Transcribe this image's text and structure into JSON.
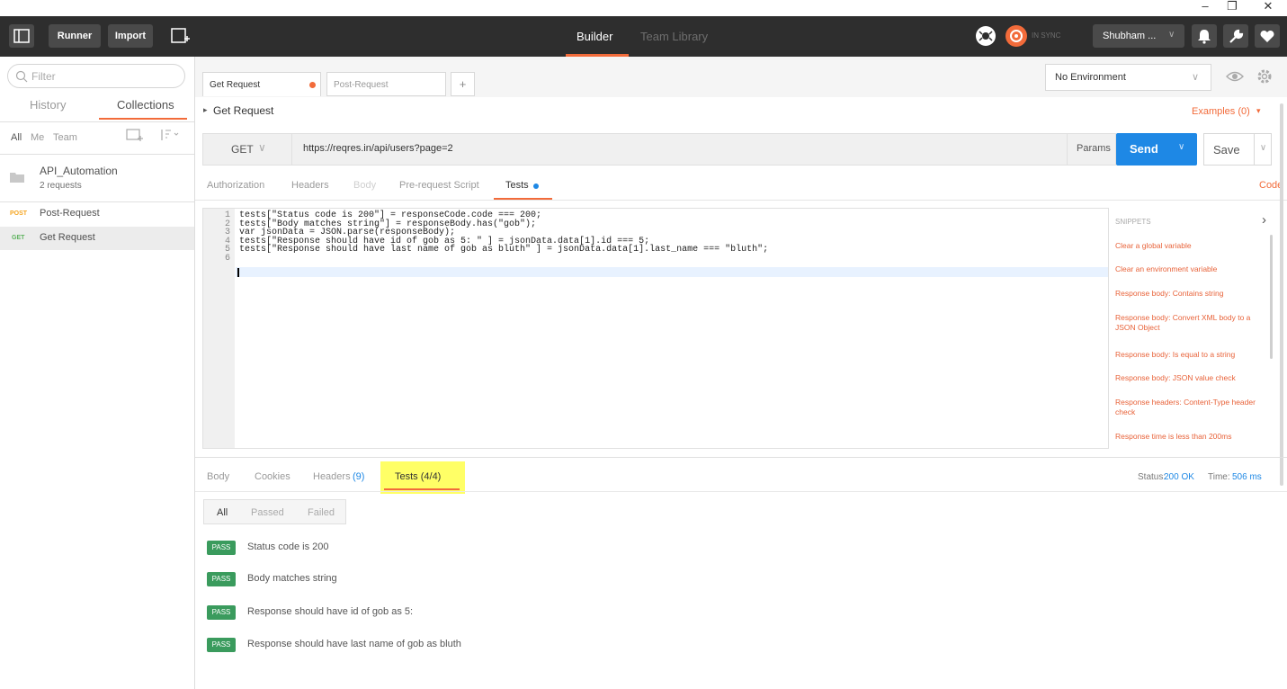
{
  "window": {
    "minimize": "–",
    "maximize": "❐",
    "close": "✕"
  },
  "topbar": {
    "runner": "Runner",
    "import": "Import",
    "builder": "Builder",
    "team_library": "Team Library",
    "sync": "IN SYNC",
    "user": "Shubham ... ",
    "user_caret": "∨"
  },
  "sidebar": {
    "filter_placeholder": "Filter",
    "tabs": [
      "History",
      "Collections"
    ],
    "scopes": [
      "All",
      "Me",
      "Team"
    ],
    "collection": {
      "name": "API_Automation",
      "count": "2 requests"
    },
    "requests": [
      {
        "method": "POST",
        "name": "Post-Request"
      },
      {
        "method": "GET",
        "name": "Get Request"
      }
    ]
  },
  "request_tabs": [
    "Get Request",
    "Post-Request"
  ],
  "add_tab": "+",
  "environment": {
    "selected": "No Environment",
    "caret": "∨"
  },
  "request": {
    "breadcrumb": "Get Request",
    "examples": "Examples (0)",
    "method": "GET",
    "url": "https://reqres.in/api/users?page=2",
    "params": "Params",
    "send": "Send",
    "save": "Save"
  },
  "request_subtabs": [
    "Authorization",
    "Headers",
    "Body",
    "Pre-request Script",
    "Tests"
  ],
  "code_link": "Code",
  "editor": {
    "line_numbers": [
      "1",
      "2",
      "3",
      "4",
      "5",
      "6"
    ],
    "lines": [
      "tests[\"Status code is 200\"] = responseCode.code === 200;",
      "tests[\"Body matches string\"] = responseBody.has(\"gob\");",
      "var jsonData = JSON.parse(responseBody);",
      "tests[\"Response should have id of gob as 5: \" ] = jsonData.data[1].id === 5;",
      "tests[\"Response should have last name of gob as bluth\" ] = jsonData.data[1].last_name === \"bluth\";",
      ""
    ]
  },
  "snippets": {
    "title": "SNIPPETS",
    "items": [
      "Clear a global variable",
      "Clear an environment variable",
      "Response body: Contains string",
      "Response body: Convert XML body to a JSON Object",
      "Response body: Is equal to a string",
      "Response body: JSON value check",
      "Response headers: Content-Type header check",
      "Response time is less than 200ms"
    ]
  },
  "response_tabs": {
    "body": "Body",
    "cookies": "Cookies",
    "headers": "Headers",
    "headers_count": "(9)",
    "tests": "Tests (4/4)"
  },
  "status": {
    "status_label": "Status:",
    "status_value": "200 OK",
    "time_label": "Time:",
    "time_value": "506 ms"
  },
  "filters": [
    "All",
    "Passed",
    "Failed"
  ],
  "results": [
    {
      "badge": "PASS",
      "text": "Status code is 200"
    },
    {
      "badge": "PASS",
      "text": "Body matches string"
    },
    {
      "badge": "PASS",
      "text": "Response should have id of gob as 5:"
    },
    {
      "badge": "PASS",
      "text": "Response should have last name of gob as bluth"
    }
  ],
  "colors": {
    "accent": "#f26b3a",
    "send": "#1e88e5",
    "pass": "#3a9b5d",
    "highlight": "#ffff66"
  }
}
